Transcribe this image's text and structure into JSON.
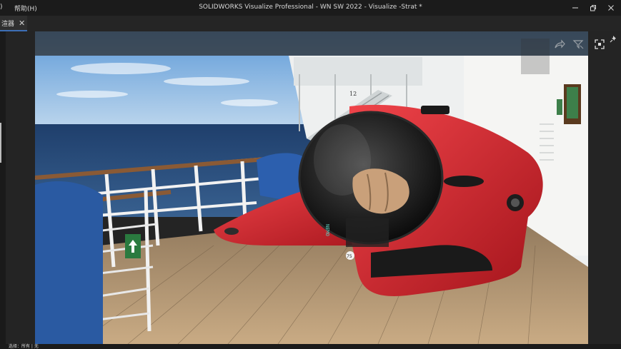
{
  "window": {
    "title": "SOLIDWORKS Visualize Professional - WN SW 2022 - Visualize -Strat *",
    "menu_cut": ")",
    "menu_help": "帮助(H)"
  },
  "tabs": [
    {
      "label": "渲器",
      "active": true
    }
  ],
  "status": {
    "text": "选择：所有 | 无"
  },
  "scene": {
    "deck_sign": "12",
    "sub_label": "NEMO",
    "badge": "75"
  },
  "icons": {
    "minimize": "minimize-icon",
    "restore": "restore-icon",
    "close": "close-icon",
    "tab_close": "close-icon",
    "share": "share-icon",
    "filter": "filter-icon",
    "fit": "fit-view-icon",
    "pin": "pin-icon"
  },
  "colors": {
    "accent": "#3d6fb6",
    "submarine_red": "#d3232c",
    "sea": "#2d4f7e",
    "sky": "#7fb3e6"
  }
}
